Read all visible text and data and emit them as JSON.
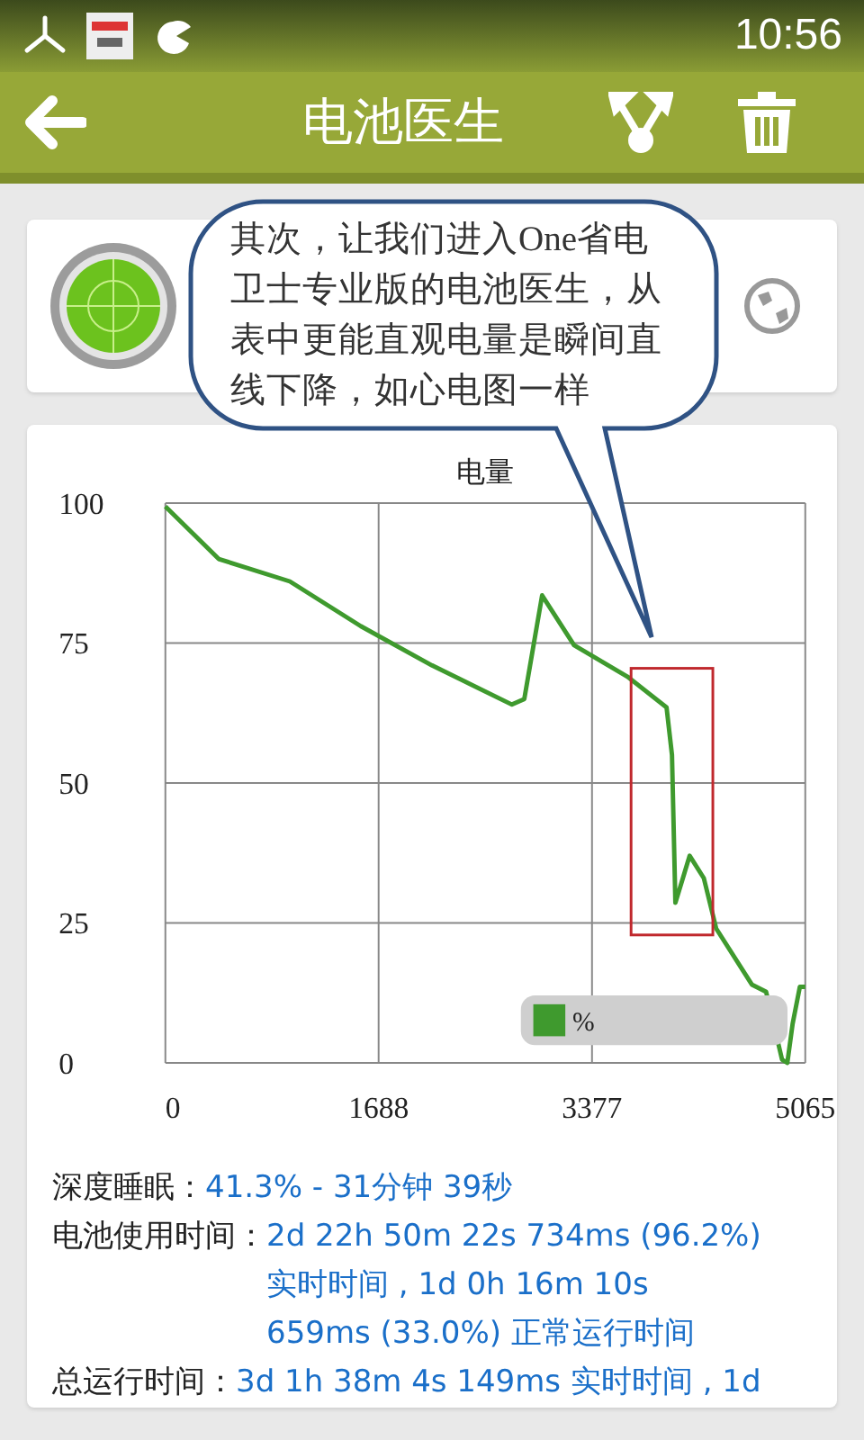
{
  "status_bar": {
    "time": "10:56"
  },
  "toolbar": {
    "title": "电池医生"
  },
  "tutorial": {
    "bubble_text": "其次，让我们进入One省电卫士专业版的电池医生，从表中更能直观电量是瞬间直线下降，如心电图一样",
    "highlight": true
  },
  "chart_data": {
    "type": "line",
    "title": "电量",
    "xlim": [
      0,
      5065
    ],
    "ylim": [
      0,
      100
    ],
    "xticks": [
      0,
      1688,
      3377,
      5065
    ],
    "yticks": [
      0,
      25,
      50,
      75,
      100
    ],
    "x": [
      0,
      422,
      985,
      1547,
      2110,
      2743,
      2841,
      2982,
      3235,
      3657,
      3967,
      4010,
      4037,
      4150,
      4262,
      4360,
      4642,
      4755,
      4881,
      4923,
      4965,
      5022,
      5065
    ],
    "series": [
      {
        "name": "%",
        "color": "#3f9a2e",
        "values": [
          99.4,
          90,
          86,
          78,
          71,
          64,
          65,
          83.5,
          74.6,
          69,
          63.5,
          55,
          28.6,
          37,
          33,
          24,
          14,
          12.7,
          0.6,
          0,
          7,
          13.6,
          13.6
        ]
      }
    ],
    "grid": true
  },
  "stats": [
    {
      "label": "深度睡眠：",
      "lines": [
        "41.3% - 31分钟 39秒"
      ]
    },
    {
      "label": "电池使用时间：",
      "lines": [
        "2d 22h 50m 22s 734ms (96.2%)",
        "实时时间 , 1d 0h 16m 10s",
        "659ms (33.0%) 正常运行时间"
      ]
    },
    {
      "label": "总运行时间：",
      "lines": [
        "3d 1h 38m 4s 149ms 实时时间 , 1d"
      ]
    }
  ]
}
